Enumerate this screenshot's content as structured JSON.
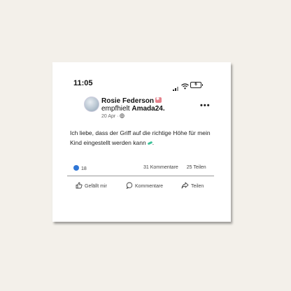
{
  "status": {
    "time": "11:05",
    "battery": "6"
  },
  "post": {
    "author": "Rosie Federson",
    "action_prefix": "empfhielt",
    "recommended": "Amada24.",
    "date": "20 Apr",
    "text": "Ich liebe, dass der Griff auf die richtige Höhe für mein Kind eingestellt werden kann"
  },
  "stats": {
    "reactions": "18",
    "comments": "31 Kommentare",
    "shares": "25 Teilen"
  },
  "actions": {
    "like": "Gefällt mir",
    "comment": "Kommentare",
    "share": "Teilen"
  },
  "colors": {
    "accent": "#2f76d6",
    "badge": "#e5828c"
  }
}
